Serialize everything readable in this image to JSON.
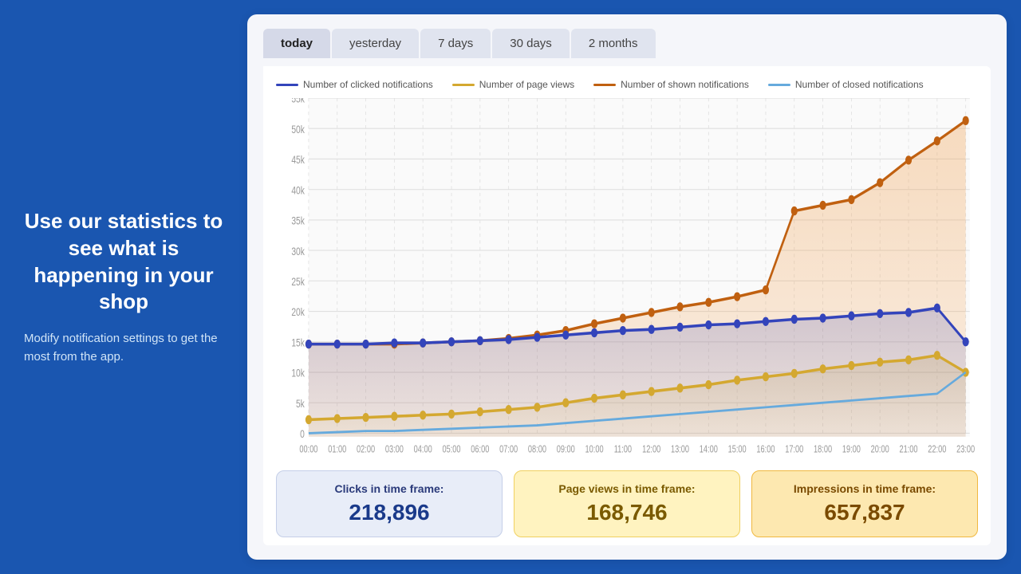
{
  "left": {
    "heading": "Use our statistics to see what is happening in your shop",
    "description": "Modify notification settings to get the most from the app."
  },
  "tabs": [
    {
      "label": "today",
      "active": true
    },
    {
      "label": "yesterday",
      "active": false
    },
    {
      "label": "7 days",
      "active": false
    },
    {
      "label": "30 days",
      "active": false
    },
    {
      "label": "2 months",
      "active": false
    }
  ],
  "legend": [
    {
      "label": "Number of clicked notifications",
      "color": "#3344bb"
    },
    {
      "label": "Number of page views",
      "color": "#d4a830"
    },
    {
      "label": "Number of shown notifications",
      "color": "#c06010"
    },
    {
      "label": "Number of closed notifications",
      "color": "#66aadd"
    }
  ],
  "yAxis": [
    "55k",
    "50k",
    "45k",
    "40k",
    "35k",
    "30k",
    "25k",
    "20k",
    "15k",
    "10k",
    "5k",
    "0"
  ],
  "xAxis": [
    "00:00",
    "01:00",
    "02:00",
    "03:00",
    "04:00",
    "05:00",
    "06:00",
    "07:00",
    "08:00",
    "09:00",
    "10:00",
    "11:00",
    "12:00",
    "13:00",
    "14:00",
    "15:00",
    "16:00",
    "17:00",
    "18:00",
    "19:00",
    "20:00",
    "21:00",
    "22:00",
    "23:00"
  ],
  "stats": [
    {
      "label": "Clicks in time frame:",
      "value": "218,896",
      "type": "blue"
    },
    {
      "label": "Page views in time frame:",
      "value": "168,746",
      "type": "yellow"
    },
    {
      "label": "Impressions in time frame:",
      "value": "657,837",
      "type": "orange"
    }
  ],
  "colors": {
    "clicked": "#3344bb",
    "pageviews": "#d4a830",
    "shown": "#c06010",
    "closed": "#66aadd"
  }
}
